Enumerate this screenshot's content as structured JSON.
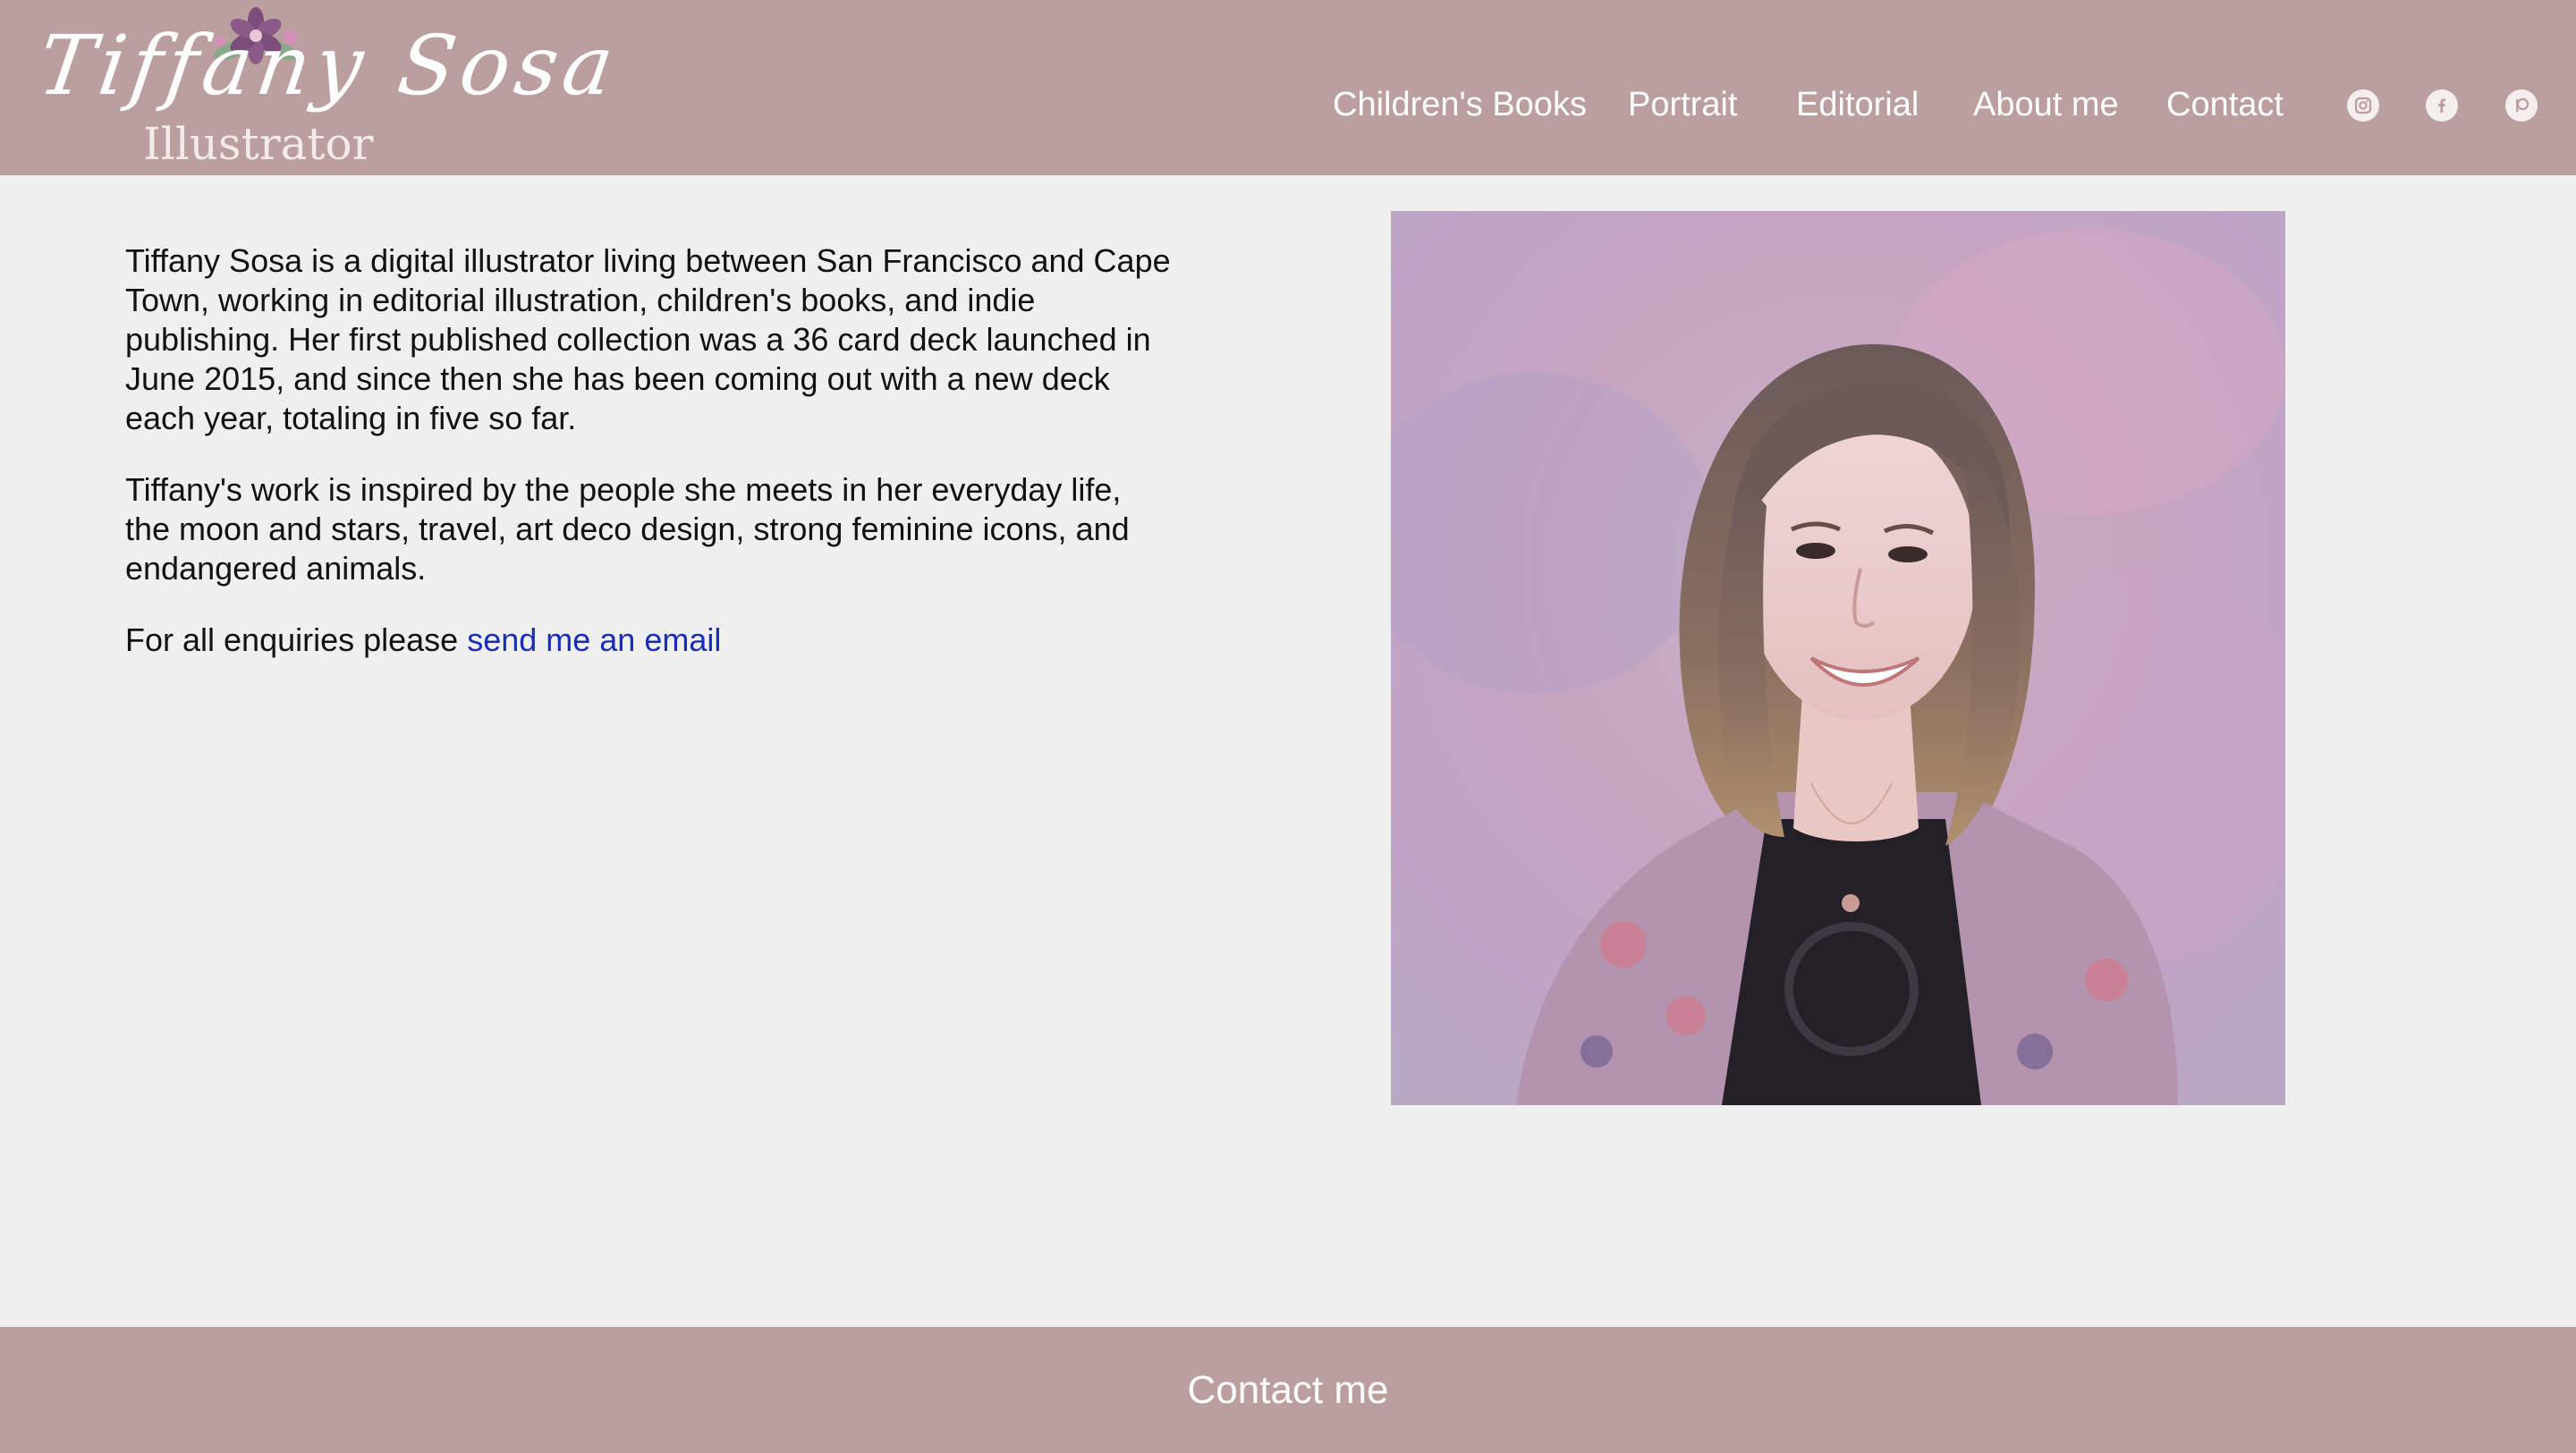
{
  "header": {
    "logo_name": "Tiffany Sosa",
    "logo_subtitle": "Illustrator",
    "nav": [
      {
        "label": "Children's Books"
      },
      {
        "label": "Portrait"
      },
      {
        "label": "Editorial"
      },
      {
        "label": "About me"
      },
      {
        "label": "Contact"
      }
    ],
    "social": [
      "instagram-icon",
      "facebook-icon",
      "patreon-icon"
    ]
  },
  "bio": {
    "paragraph_1": "Tiffany Sosa is a digital illustrator living between San Francisco and Cape Town, working in editorial illustration, children's books, and indie publishing. Her first published collection was a 36 card deck launched in June 2015, and since then she has been coming out with a new deck each year, totaling in five so far.",
    "paragraph_2": "Tiffany's work is inspired by the people she meets in her everyday life, the moon and stars, travel, art deco design, strong feminine icons, and endangered animals.",
    "enquiry_prefix": "For all enquiries please ",
    "enquiry_link": "send me an email"
  },
  "footer": {
    "contact_label": "Contact me"
  },
  "colors": {
    "header_bg": "#bb9e9e",
    "page_bg": "#efefef",
    "link": "#1a2db8"
  }
}
